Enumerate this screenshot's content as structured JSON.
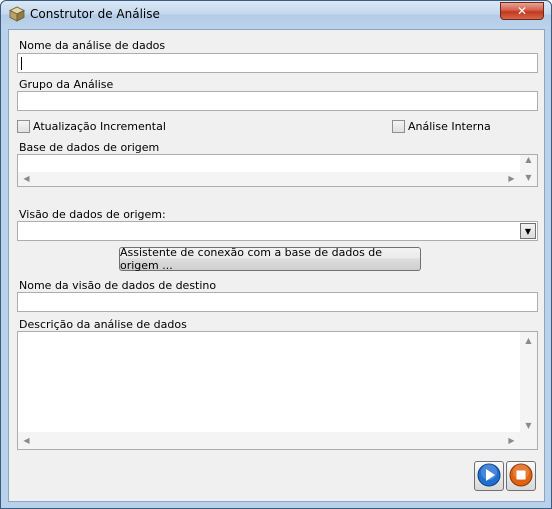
{
  "window": {
    "title": "Construtor de Análise",
    "close_label": "✕"
  },
  "form": {
    "analysis_name_label": "Nome da análise de dados",
    "analysis_name_value": "",
    "analysis_group_label": "Grupo da Análise",
    "analysis_group_value": "",
    "incremental_update_label": "Atualização Incremental",
    "incremental_update_checked": false,
    "internal_analysis_label": "Análise Interna",
    "internal_analysis_checked": false,
    "source_database_label": "Base de dados de origem",
    "source_view_label": "Visão de dados de origem:",
    "source_view_value": "",
    "connection_wizard_label": "Assistente de conexão com a base de dados de origem ...",
    "target_view_label": "Nome da visão de dados de destino",
    "target_view_value": "",
    "description_label": "Descrição da análise de dados",
    "description_value": ""
  },
  "icons": {
    "app": "cube-icon",
    "next": "play-icon",
    "stop": "stop-icon"
  },
  "colors": {
    "next_button": "#1f6fd0",
    "stop_button": "#e0620f"
  }
}
